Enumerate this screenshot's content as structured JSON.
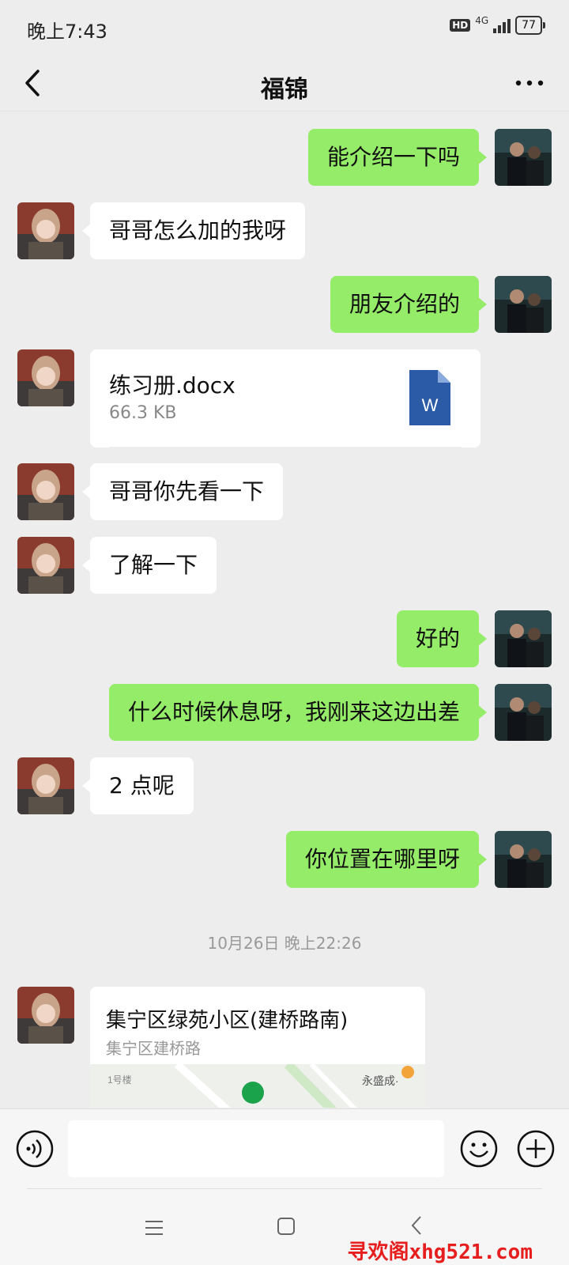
{
  "status_bar": {
    "time": "晚上7:43",
    "hd": "HD",
    "network": "4G",
    "battery": "77"
  },
  "header": {
    "title": "福锦",
    "back_icon": "chevron-left-icon",
    "more_icon": "more-dots-icon"
  },
  "messages": [
    {
      "side": "me",
      "type": "text",
      "text": "能介绍一下吗"
    },
    {
      "side": "other",
      "type": "text",
      "text": "哥哥怎么加的我呀"
    },
    {
      "side": "me",
      "type": "text",
      "text": "朋友介绍的"
    },
    {
      "side": "other",
      "type": "file",
      "file_name": "练习册.docx",
      "file_size": "66.3 KB",
      "icon": "word-doc-icon"
    },
    {
      "side": "other",
      "type": "text",
      "text": "哥哥你先看一下"
    },
    {
      "side": "other",
      "type": "text",
      "text": "了解一下"
    },
    {
      "side": "me",
      "type": "text",
      "text": "好的"
    },
    {
      "side": "me",
      "type": "text",
      "text": "什么时候休息呀，我刚来这边出差"
    },
    {
      "side": "other",
      "type": "text",
      "text": "2 点呢"
    },
    {
      "side": "me",
      "type": "text",
      "text": "你位置在哪里呀"
    }
  ],
  "timestamp": "10月26日 晚上22:26",
  "location": {
    "name": "集宁区绿苑小区(建桥路南)",
    "address": "集宁区建桥路",
    "map_label_1": "1号楼",
    "map_label_2": "永盛成·"
  },
  "input_bar": {
    "voice_icon": "voice-icon",
    "emoji_icon": "emoji-icon",
    "plus_icon": "plus-circle-icon"
  },
  "nav_bar": {
    "menu_icon": "menu-icon",
    "home_icon": "home-square-icon",
    "back_icon": "back-triangle-icon"
  },
  "watermark": "寻欢阁xhg521.com"
}
